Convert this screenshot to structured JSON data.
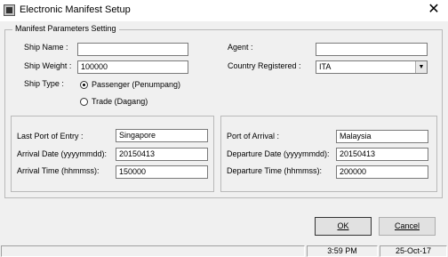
{
  "window": {
    "title": "Electronic Manifest Setup",
    "close_symbol": "✕"
  },
  "manifest_group": {
    "title": "Manifest Parameters Setting",
    "ship_name_label": "Ship Name :",
    "ship_name_value": "",
    "agent_label": "Agent :",
    "agent_value": "",
    "ship_weight_label": "Ship Weight :",
    "ship_weight_value": "100000",
    "country_registered_label": "Country Registered :",
    "country_registered_value": "ITA",
    "ship_type_label": "Ship Type :",
    "ship_type_options": [
      {
        "label": "Passenger (Penumpang)",
        "selected": true
      },
      {
        "label": "Trade (Dagang)",
        "selected": false
      }
    ]
  },
  "departure_panel": {
    "last_port_label": "Last Port of Entry :",
    "last_port_value": "Singapore",
    "arrival_date_label": "Arrival Date (yyyymmdd):",
    "arrival_date_value": "20150413",
    "arrival_time_label": "Arrival Time (hhmmss):",
    "arrival_time_value": "150000"
  },
  "arrival_panel": {
    "port_of_arrival_label": "Port of Arrival :",
    "port_of_arrival_value": "Malaysia",
    "departure_date_label": "Departure Date (yyyymmdd):",
    "departure_date_value": "20150413",
    "departure_time_label": "Departure Time (hhmmss):",
    "departure_time_value": "200000"
  },
  "buttons": {
    "ok_label": "OK",
    "cancel_label": "Cancel"
  },
  "statusbar": {
    "time": "3:59 PM",
    "date": "25-Oct-17"
  },
  "icons": {
    "app": "app-icon",
    "close": "close-icon",
    "dropdown": "chevron-down-icon"
  }
}
